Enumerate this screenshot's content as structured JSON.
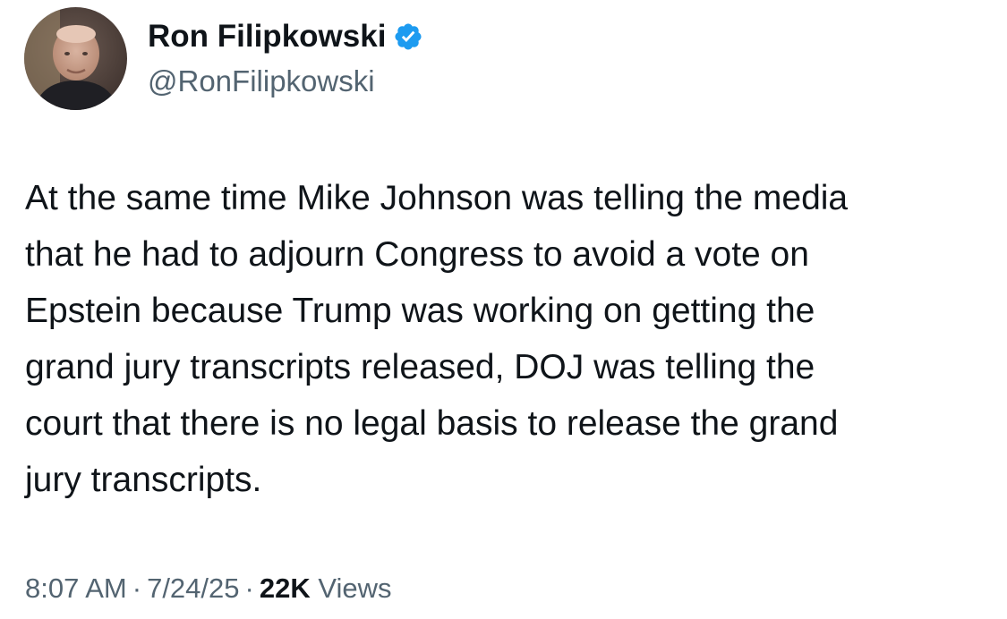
{
  "author": {
    "display_name": "Ron Filipkowski",
    "handle": "@RonFilipkowski",
    "verified_icon": "verified-badge-icon",
    "avatar_icon": "profile-photo"
  },
  "tweet": {
    "text": "At the same time Mike Johnson was telling the media\nthat he had to adjourn Congress to avoid a vote on\nEpstein because Trump was working on getting the\ngrand jury transcripts released, DOJ was telling the\ncourt that there is no legal basis to release the grand\njury transcripts."
  },
  "meta": {
    "time": "8:07 AM",
    "separator": "·",
    "date": "7/24/25",
    "views_count": "22K",
    "views_label": "Views"
  },
  "colors": {
    "text_primary": "#0f1419",
    "text_secondary": "#536471",
    "verified_blue": "#1d9bf0"
  }
}
